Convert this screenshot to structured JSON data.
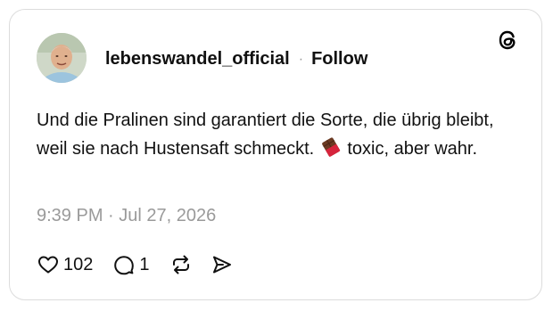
{
  "post": {
    "username": "lebenswandel_official",
    "separator": "·",
    "follow_label": "Follow",
    "text_before_emoji": "Und die Pralinen sind garantiert die Sorte, die übrig bleibt, weil sie nach Hustensaft schmeckt.",
    "emoji_icon": "chocolate-bar-icon",
    "text_after_emoji": "toxic, aber wahr.",
    "timestamp": "9:39 PM · Jul 27, 2026",
    "like_count": "102",
    "reply_count": "1"
  },
  "icons": {
    "logo": "threads-logo-icon",
    "like": "heart-icon",
    "reply": "comment-icon",
    "repost": "repost-icon",
    "share": "send-icon"
  }
}
